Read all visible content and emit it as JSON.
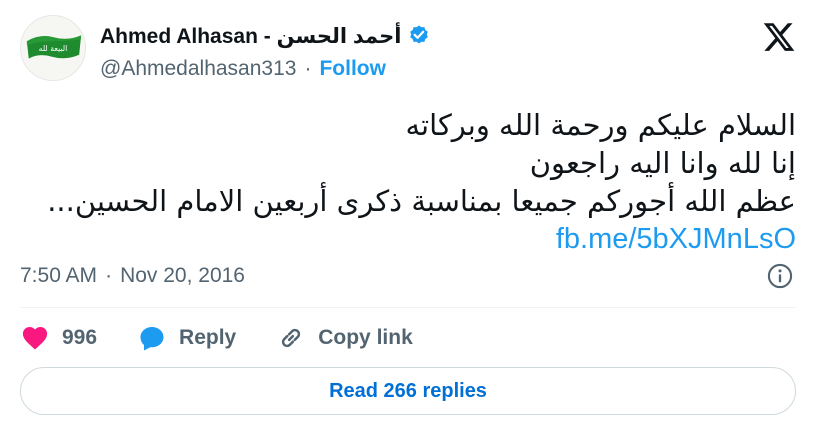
{
  "author": {
    "display_name": "Ahmed Alhasan - أحمد الحسن",
    "handle": "@Ahmedalhasan313",
    "separator": "·",
    "follow_label": "Follow",
    "avatar_banner_text": "البيعة لله",
    "verified": true
  },
  "tweet": {
    "lines": [
      "السلام عليكم ورحمة الله وبركاته",
      "إنا لله وانا اليه راجعون",
      "عظم الله أجوركم جميعا بمناسبة ذكرى أربعين الامام الحسين..."
    ],
    "link": "fb.me/5bXJMnLsO"
  },
  "meta": {
    "time": "7:50 AM",
    "separator": "·",
    "date": "Nov 20, 2016"
  },
  "actions": {
    "like_count": "996",
    "reply_label": "Reply",
    "copy_link_label": "Copy link"
  },
  "read_replies_label": "Read 266 replies",
  "colors": {
    "accent": "#1d9bf0",
    "like": "#f91880",
    "muted": "#536471"
  },
  "icons": [
    "verified-icon",
    "x-logo-icon",
    "info-icon",
    "heart-icon",
    "reply-bubble-icon",
    "link-icon"
  ]
}
